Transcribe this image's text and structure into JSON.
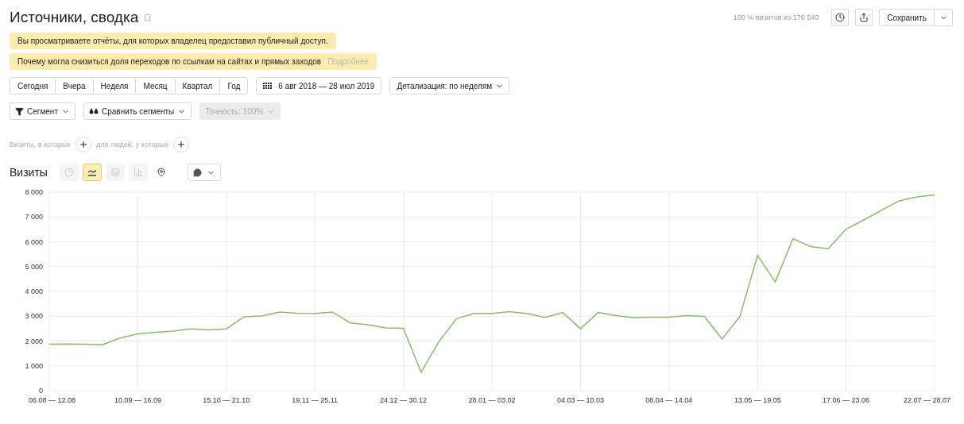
{
  "header": {
    "title": "Источники, сводка",
    "sample_info": "100 % визитов из 176 540",
    "save_label": "Сохранить"
  },
  "notices": [
    {
      "text": "Вы просматриваете отчёты, для которых владелец предоставил публичный доступ."
    },
    {
      "text": "Почему могла снизиться доля переходов по ссылкам на сайтах и прямых заходов",
      "link": "Подробнее"
    }
  ],
  "periods": [
    {
      "label": "Сегодня",
      "selected": false
    },
    {
      "label": "Вчера",
      "selected": false
    },
    {
      "label": "Неделя",
      "selected": false
    },
    {
      "label": "Месяц",
      "selected": false
    },
    {
      "label": "Квартал",
      "selected": false
    },
    {
      "label": "Год",
      "selected": false
    }
  ],
  "date_range": "6 авг 2018 — 28 июл 2019",
  "detail": "Детализация: по неделям",
  "segment_controls": [
    {
      "kind": "segment",
      "label": "Сегмент",
      "disabled": false
    },
    {
      "kind": "compare",
      "label": "Сравнить сегменты",
      "disabled": false
    },
    {
      "kind": "accuracy",
      "label": "Точность: 100%",
      "disabled": true
    }
  ],
  "filters": [
    {
      "label": "Визиты, в которых"
    },
    {
      "label": "для людей, у которых"
    }
  ],
  "chart_section": {
    "title": "Визиты",
    "chart_types": [
      {
        "kind": "pie",
        "selected": false,
        "disabled": true
      },
      {
        "kind": "line",
        "selected": true,
        "disabled": false
      },
      {
        "kind": "stacked",
        "selected": false,
        "disabled": true
      },
      {
        "kind": "bars",
        "selected": false,
        "disabled": true
      },
      {
        "kind": "map",
        "selected": false,
        "disabled": false
      }
    ],
    "chart_data": {
      "type": "line",
      "categories": [
        "06.08 — 12.08",
        null,
        null,
        null,
        null,
        "10.09 — 16.09",
        null,
        null,
        null,
        null,
        "15.10 — 21.10",
        null,
        null,
        null,
        null,
        "19.11 — 25.11",
        null,
        null,
        null,
        null,
        "24.12 — 30.12",
        null,
        null,
        null,
        null,
        "28.01 — 03.02",
        null,
        null,
        null,
        null,
        "04.03 — 10.03",
        null,
        null,
        null,
        null,
        "08.04 — 14.04",
        null,
        null,
        null,
        null,
        "13.05 — 19.05",
        null,
        null,
        null,
        null,
        "17.06 — 23.06",
        null,
        null,
        null,
        null,
        "22.07 — 28.07"
      ],
      "series": [
        {
          "color": "#8dbb6a",
          "values": [
            1870,
            1880,
            1870,
            1850,
            2120,
            2290,
            2350,
            2400,
            2490,
            2450,
            2490,
            2980,
            3010,
            3170,
            3120,
            3110,
            3170,
            2730,
            2660,
            2530,
            2510,
            740,
            1970,
            2900,
            3110,
            3110,
            3180,
            3100,
            2950,
            3150,
            2500,
            3150,
            3020,
            2940,
            2960,
            2960,
            3020,
            2990,
            2080,
            2990,
            5450,
            4380,
            6120,
            5810,
            5720,
            6510,
            6880,
            7270,
            7650,
            7810,
            7890
          ]
        }
      ],
      "ylim": [
        0,
        8000
      ],
      "grid": true,
      "yticks": [
        {
          "value": 0,
          "label": "0"
        },
        {
          "value": 1000,
          "label": "1 000"
        },
        {
          "value": 2000,
          "label": "2 000"
        },
        {
          "value": 3000,
          "label": "3 000"
        },
        {
          "value": 4000,
          "label": "4 000"
        },
        {
          "value": 5000,
          "label": "5 000"
        },
        {
          "value": 6000,
          "label": "6 000"
        },
        {
          "value": 7000,
          "label": "7 000"
        },
        {
          "value": 8000,
          "label": "8 000"
        }
      ]
    }
  }
}
